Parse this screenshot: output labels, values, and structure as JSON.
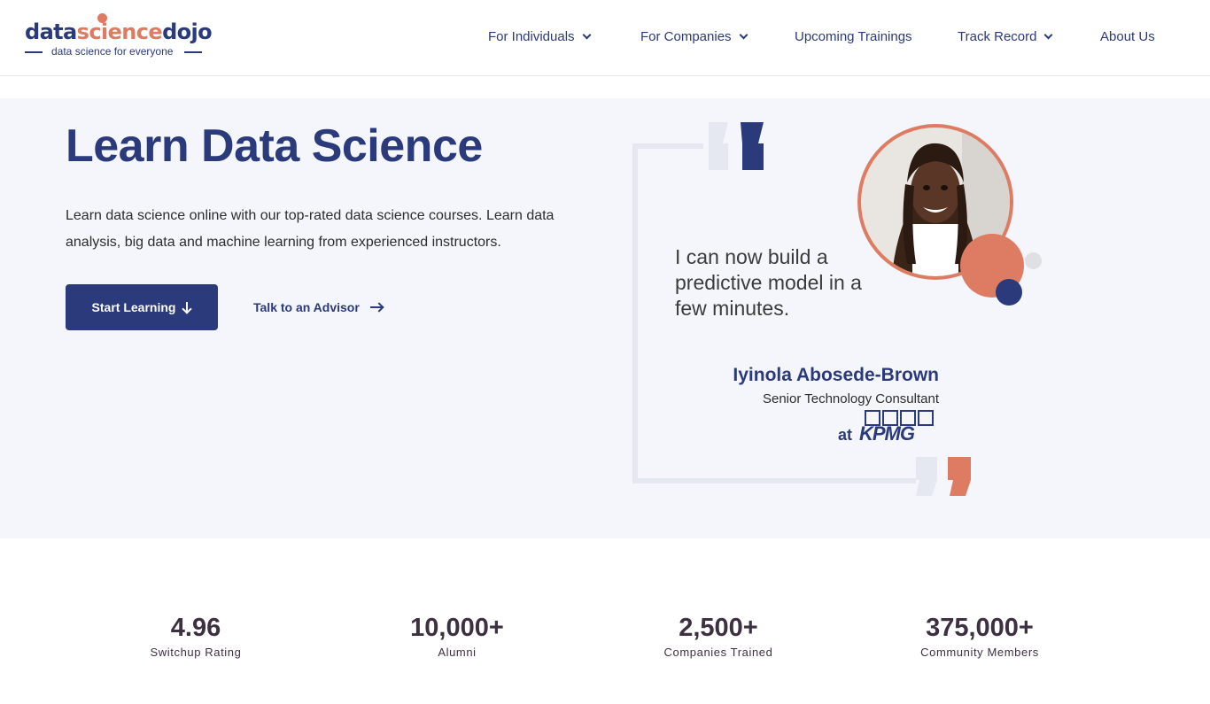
{
  "brand": {
    "logo_part1": "data",
    "logo_part2": "science",
    "logo_part3": "dojo",
    "tagline": "data science for everyone",
    "colors": {
      "primary": "#2b3a7a",
      "accent": "#de7c63",
      "hero_bg": "#f5f6fb"
    }
  },
  "nav": {
    "items": [
      {
        "label": "For Individuals",
        "has_dropdown": true,
        "icon": "chevron-down-icon"
      },
      {
        "label": "For Companies",
        "has_dropdown": true,
        "icon": "chevron-down-icon"
      },
      {
        "label": "Upcoming Trainings",
        "has_dropdown": false
      },
      {
        "label": "Track Record",
        "has_dropdown": true,
        "icon": "chevron-down-icon"
      },
      {
        "label": "About Us",
        "has_dropdown": false
      }
    ]
  },
  "hero": {
    "title": "Learn Data Science",
    "description": "Learn data science online with our top-rated data science courses. Learn data analysis, big data and machine learning from experienced instructors.",
    "primary_button": {
      "label": "Start Learning",
      "icon": "arrow-down-icon"
    },
    "secondary_link": {
      "label": "Talk to an Advisor",
      "icon": "arrow-right-icon"
    }
  },
  "testimonial": {
    "quote": "I can now build a predictive model in a few minutes.",
    "name": "Iyinola Abosede-Brown",
    "role": "Senior Technology Consultant",
    "at": "at",
    "company": "KPMG"
  },
  "stats": [
    {
      "value": "4.96",
      "label": "Switchup Rating"
    },
    {
      "value": "10,000+",
      "label": "Alumni"
    },
    {
      "value": "2,500+",
      "label": "Companies Trained"
    },
    {
      "value": "375,000+",
      "label": "Community Members"
    }
  ]
}
